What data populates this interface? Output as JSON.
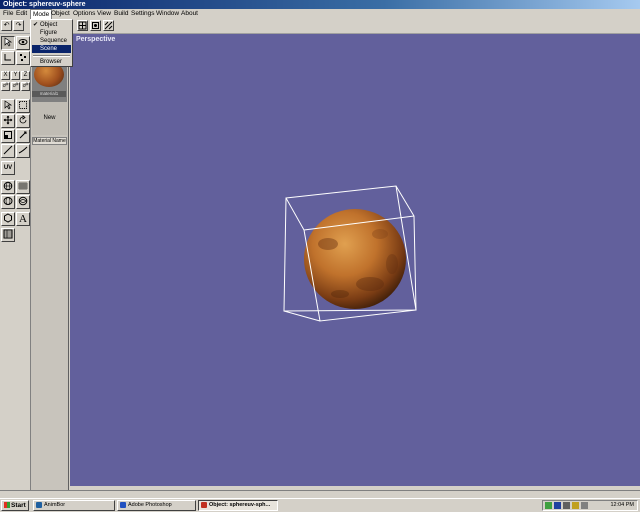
{
  "window": {
    "title": "Object: sphereuv-sphere"
  },
  "menubar": {
    "items": [
      "File",
      "Edit",
      "Mode",
      "Object",
      "Options",
      "View",
      "Build",
      "Settings",
      "Window",
      "About"
    ]
  },
  "mode_menu": {
    "items": [
      {
        "label": "Object",
        "checked": true
      },
      {
        "label": "Figure",
        "checked": false
      },
      {
        "label": "Sequence",
        "checked": false
      },
      {
        "label": "Scene",
        "checked": false,
        "highlighted": true
      },
      {
        "label": "Browser",
        "checked": false
      }
    ],
    "check_glyph": "✔"
  },
  "toolbar": {
    "undo_glyph": "↶",
    "redo_glyph": "↷"
  },
  "tools": {
    "axis_labels": [
      "X",
      "Y",
      "Z"
    ],
    "uv_label": "UV",
    "text_tool_label": "A"
  },
  "material_panel": {
    "material_label": "material1",
    "new_label": "New",
    "name_label": "Material Name"
  },
  "viewport": {
    "label": "Perspective",
    "background": "#62609c",
    "sphere_color": "#c0722c"
  },
  "taskbar": {
    "start_label": "Start",
    "tasks": [
      {
        "label": "AnimBor",
        "icon": "animator-icon",
        "color": "#2060a0"
      },
      {
        "label": "Adobe Photoshop",
        "icon": "photoshop-icon",
        "color": "#2050c0"
      },
      {
        "label": "Object: sphereuv-sph...",
        "icon": "animation-master-icon",
        "color": "#c03020",
        "active": true
      }
    ],
    "clock": "12:04 PM"
  }
}
